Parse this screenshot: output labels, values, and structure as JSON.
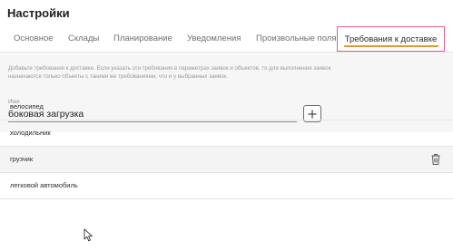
{
  "page": {
    "title": "Настройки"
  },
  "tabs": [
    {
      "label": "Основное",
      "active": false
    },
    {
      "label": "Склады",
      "active": false
    },
    {
      "label": "Планирование",
      "active": false
    },
    {
      "label": "Уведомления",
      "active": false
    },
    {
      "label": "Произвольные поля",
      "active": false
    },
    {
      "label": "Требования к доставке",
      "active": true
    }
  ],
  "colors": {
    "active_tab_border": "#e06288",
    "active_tab_underline": "#e49a2a"
  },
  "description": "Добавьте требования к доставке. Если указать эти требования в параметрах заявок и объектов, то для выполнения заявок назначаются только объекты с такими же требованиями, что и у выбранных заявок.",
  "form": {
    "name_label": "Имя",
    "name_value": "боковая загрузка",
    "add_icon": "plus-icon"
  },
  "requirements": [
    {
      "label": "велосипед"
    },
    {
      "label": "холодильник"
    },
    {
      "label": "грузчик",
      "hovered": true,
      "action_icon": "trash-icon"
    },
    {
      "label": "легковой автомобиль"
    }
  ]
}
